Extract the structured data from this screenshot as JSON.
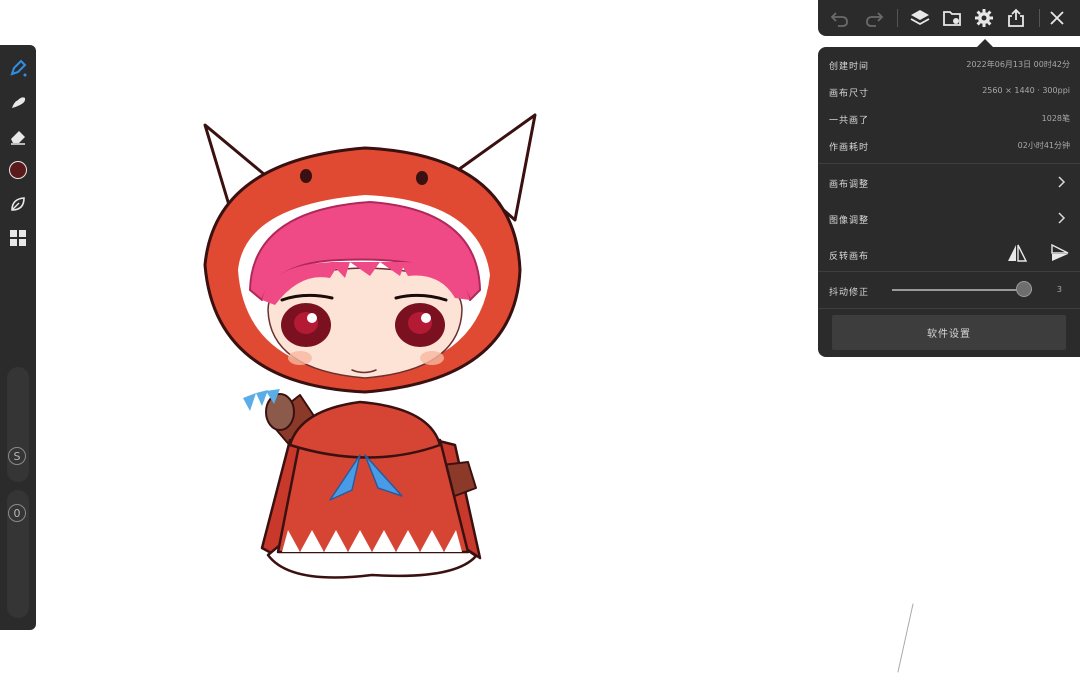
{
  "toolbar": {
    "undo_icon": "undo-icon",
    "redo_icon": "redo-icon",
    "layers_icon": "layers-icon",
    "import_icon": "import-folder-icon",
    "settings_icon": "gear-icon",
    "share_icon": "share-icon",
    "close_icon": "close-icon"
  },
  "left_tools": {
    "items": [
      "brush-icon",
      "smudge-icon",
      "eraser-icon",
      "color-swatch",
      "leaf-brush-icon",
      "gallery-grid-icon"
    ],
    "current_color": "#5a1a1a",
    "size_slider_label": "S",
    "opacity_slider_label": "0",
    "accent": "#2f8fe6"
  },
  "info": {
    "created_label": "创建时间",
    "created_value": "2022年06月13日  00时42分",
    "canvas_size_label": "画布尺寸",
    "canvas_size_value": "2560 × 1440  ·  300ppi",
    "strokes_label": "一共画了",
    "strokes_value": "1028笔",
    "time_spent_label": "作画耗时",
    "time_spent_value": "02小时41分钟"
  },
  "menu": {
    "canvas_adjust": "画布调整",
    "image_adjust": "图像调整",
    "flip_canvas": "反转画布",
    "stabilizer_label": "抖动修正",
    "stabilizer_value": "3",
    "software_settings": "软件设置"
  }
}
